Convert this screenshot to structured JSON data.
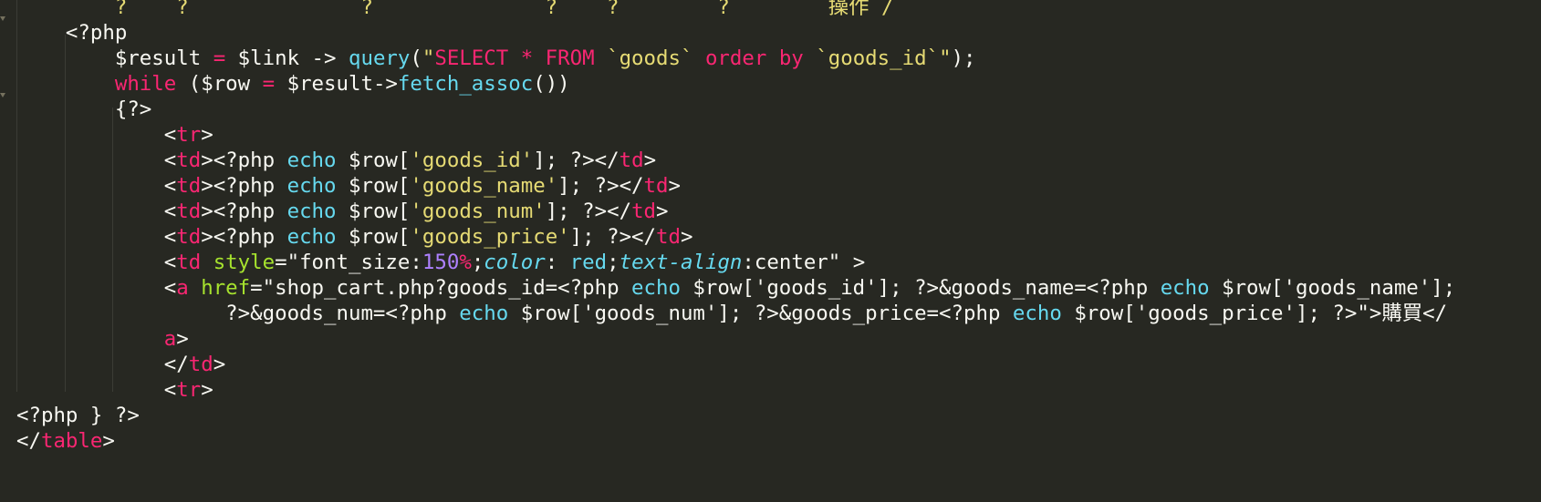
{
  "editor": {
    "theme_colors": {
      "background": "#272822",
      "plain": "#f8f8f2",
      "keyword": "#f92672",
      "function": "#66d9ef",
      "string": "#e6db74",
      "attribute": "#a6e22e",
      "number": "#ae81ff"
    },
    "lines": [
      {
        "tokens": [
          {
            "t": "cut",
            "v": "        ?    ?              ?              ?    ?        ?        操作 /"
          }
        ]
      },
      {
        "tokens": [
          {
            "t": "plain",
            "v": "    <?php"
          }
        ]
      },
      {
        "tokens": [
          {
            "t": "plain",
            "v": "        $result "
          },
          {
            "t": "op",
            "v": "="
          },
          {
            "t": "plain",
            "v": " $link -> "
          },
          {
            "t": "func",
            "v": "query"
          },
          {
            "t": "plain",
            "v": "("
          },
          {
            "t": "str",
            "v": "\""
          },
          {
            "t": "kw",
            "v": "SELECT * FROM "
          },
          {
            "t": "str",
            "v": "`goods` "
          },
          {
            "t": "kw",
            "v": "order by "
          },
          {
            "t": "str",
            "v": "`goods_id`\""
          },
          {
            "t": "plain",
            "v": ");"
          }
        ]
      },
      {
        "tokens": [
          {
            "t": "plain",
            "v": "        "
          },
          {
            "t": "kw",
            "v": "while"
          },
          {
            "t": "plain",
            "v": " ($row "
          },
          {
            "t": "op",
            "v": "="
          },
          {
            "t": "plain",
            "v": " $result->"
          },
          {
            "t": "func",
            "v": "fetch_assoc"
          },
          {
            "t": "plain",
            "v": "())"
          }
        ]
      },
      {
        "tokens": [
          {
            "t": "plain",
            "v": "        {?>"
          }
        ]
      },
      {
        "tokens": [
          {
            "t": "plain",
            "v": "            <"
          },
          {
            "t": "tag",
            "v": "tr"
          },
          {
            "t": "plain",
            "v": ">"
          }
        ]
      },
      {
        "tokens": [
          {
            "t": "plain",
            "v": "            <"
          },
          {
            "t": "tag",
            "v": "td"
          },
          {
            "t": "plain",
            "v": "><?php "
          },
          {
            "t": "func",
            "v": "echo"
          },
          {
            "t": "plain",
            "v": " $row["
          },
          {
            "t": "str",
            "v": "'goods_id'"
          },
          {
            "t": "plain",
            "v": "]; ?></"
          },
          {
            "t": "tag",
            "v": "td"
          },
          {
            "t": "plain",
            "v": ">"
          }
        ]
      },
      {
        "tokens": [
          {
            "t": "plain",
            "v": "            <"
          },
          {
            "t": "tag",
            "v": "td"
          },
          {
            "t": "plain",
            "v": "><?php "
          },
          {
            "t": "func",
            "v": "echo"
          },
          {
            "t": "plain",
            "v": " $row["
          },
          {
            "t": "str",
            "v": "'goods_name'"
          },
          {
            "t": "plain",
            "v": "]; ?></"
          },
          {
            "t": "tag",
            "v": "td"
          },
          {
            "t": "plain",
            "v": ">"
          }
        ]
      },
      {
        "tokens": [
          {
            "t": "plain",
            "v": "            <"
          },
          {
            "t": "tag",
            "v": "td"
          },
          {
            "t": "plain",
            "v": "><?php "
          },
          {
            "t": "func",
            "v": "echo"
          },
          {
            "t": "plain",
            "v": " $row["
          },
          {
            "t": "str",
            "v": "'goods_num'"
          },
          {
            "t": "plain",
            "v": "]; ?></"
          },
          {
            "t": "tag",
            "v": "td"
          },
          {
            "t": "plain",
            "v": ">"
          }
        ]
      },
      {
        "tokens": [
          {
            "t": "plain",
            "v": "            <"
          },
          {
            "t": "tag",
            "v": "td"
          },
          {
            "t": "plain",
            "v": "><?php "
          },
          {
            "t": "func",
            "v": "echo"
          },
          {
            "t": "plain",
            "v": " $row["
          },
          {
            "t": "str",
            "v": "'goods_price'"
          },
          {
            "t": "plain",
            "v": "]; ?></"
          },
          {
            "t": "tag",
            "v": "td"
          },
          {
            "t": "plain",
            "v": ">"
          }
        ]
      },
      {
        "tokens": [
          {
            "t": "plain",
            "v": "            <"
          },
          {
            "t": "tag",
            "v": "td"
          },
          {
            "t": "plain",
            "v": " "
          },
          {
            "t": "attr",
            "v": "style"
          },
          {
            "t": "plain",
            "v": "=\"font_size:"
          },
          {
            "t": "num",
            "v": "150"
          },
          {
            "t": "kw",
            "v": "%"
          },
          {
            "t": "plain",
            "v": ";"
          },
          {
            "t": "prop",
            "v": "color"
          },
          {
            "t": "plain",
            "v": ": "
          },
          {
            "t": "func",
            "v": "red"
          },
          {
            "t": "plain",
            "v": ";"
          },
          {
            "t": "prop",
            "v": "text-align"
          },
          {
            "t": "plain",
            "v": ":center\" >"
          }
        ]
      },
      {
        "tokens": [
          {
            "t": "plain",
            "v": "            <"
          },
          {
            "t": "tag",
            "v": "a"
          },
          {
            "t": "plain",
            "v": " "
          },
          {
            "t": "attr",
            "v": "href"
          },
          {
            "t": "plain",
            "v": "=\"shop_cart.php?goods_id=<?php "
          },
          {
            "t": "func",
            "v": "echo"
          },
          {
            "t": "plain",
            "v": " $row['goods_id']; ?>&goods_name=<?php "
          },
          {
            "t": "func",
            "v": "echo"
          },
          {
            "t": "plain",
            "v": " $row['goods_name'];"
          }
        ]
      },
      {
        "tokens": [
          {
            "t": "plain",
            "v": "                 ?>&goods_num=<?php "
          },
          {
            "t": "func",
            "v": "echo"
          },
          {
            "t": "plain",
            "v": " $row['goods_num']; ?>&goods_price=<?php "
          },
          {
            "t": "func",
            "v": "echo"
          },
          {
            "t": "plain",
            "v": " $row['goods_price']; ?>\">購買</"
          }
        ]
      },
      {
        "tokens": [
          {
            "t": "plain",
            "v": "            "
          },
          {
            "t": "tag",
            "v": "a"
          },
          {
            "t": "plain",
            "v": ">"
          }
        ]
      },
      {
        "tokens": [
          {
            "t": "plain",
            "v": "            </"
          },
          {
            "t": "tag",
            "v": "td"
          },
          {
            "t": "plain",
            "v": ">"
          }
        ]
      },
      {
        "tokens": [
          {
            "t": "plain",
            "v": "            <"
          },
          {
            "t": "tag",
            "v": "tr"
          },
          {
            "t": "plain",
            "v": ">"
          }
        ]
      },
      {
        "tokens": [
          {
            "t": "plain",
            "v": "<?php } ?>"
          }
        ]
      },
      {
        "tokens": [
          {
            "t": "plain",
            "v": "</"
          },
          {
            "t": "tag",
            "v": "table"
          },
          {
            "t": "plain",
            "v": ">"
          }
        ]
      }
    ]
  }
}
